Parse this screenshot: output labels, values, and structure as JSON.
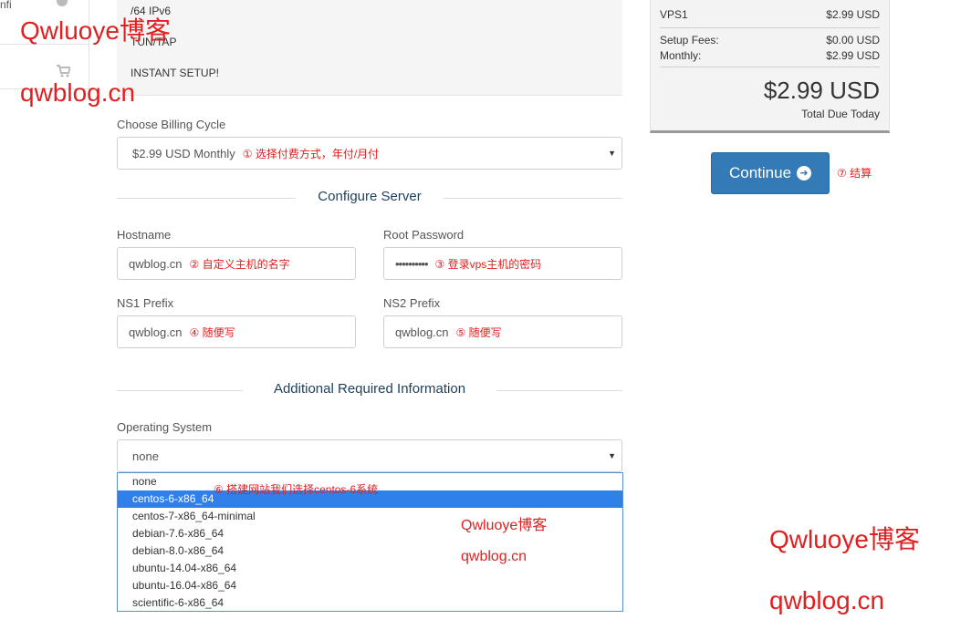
{
  "sidebar": {
    "top_label": "nfi"
  },
  "product_desc": {
    "lines": [
      "/64 IPv6",
      "TUN/TAP",
      "INSTANT SETUP!"
    ]
  },
  "billing": {
    "label": "Choose Billing Cycle",
    "value": "$2.99 USD Monthly",
    "note": "① 选择付费方式，年付/月付"
  },
  "configure_section": {
    "title": "Configure Server"
  },
  "hostname": {
    "label": "Hostname",
    "value": "qwblog.cn",
    "note": "② 自定义主机的名字"
  },
  "root_password": {
    "label": "Root Password",
    "value": "••••••••••",
    "note": "③ 登录vps主机的密码"
  },
  "ns1": {
    "label": "NS1 Prefix",
    "value": "qwblog.cn",
    "note": "④ 随便写"
  },
  "ns2": {
    "label": "NS2 Prefix",
    "value": "qwblog.cn",
    "note": "⑤ 随便写"
  },
  "additional_section": {
    "title": "Additional Required Information"
  },
  "os": {
    "label": "Operating System",
    "value": "none",
    "options": [
      "none",
      "centos-6-x86_64",
      "centos-7-x86_64-minimal",
      "debian-7.6-x86_64",
      "debian-8.0-x86_64",
      "ubuntu-14.04-x86_64",
      "ubuntu-16.04-x86_64",
      "scientific-6-x86_64"
    ],
    "selected_index": 1,
    "note": "⑥ 搭建网站我们选择centos-6系统"
  },
  "summary": {
    "item_name": "VPS1",
    "item_price": "$2.99 USD",
    "setup_label": "Setup Fees:",
    "setup_value": "$0.00 USD",
    "monthly_label": "Monthly:",
    "monthly_value": "$2.99 USD",
    "total": "$2.99 USD",
    "total_label": "Total Due Today"
  },
  "continue": {
    "label": "Continue",
    "note": "⑦ 结算"
  },
  "watermarks": {
    "brand": "Qwluoye博客",
    "site": "qwblog.cn"
  },
  "colors": {
    "accent": "#337ab7",
    "annotation": "#e02020",
    "selected": "#2f80e8",
    "heading": "#1d3f5e"
  }
}
